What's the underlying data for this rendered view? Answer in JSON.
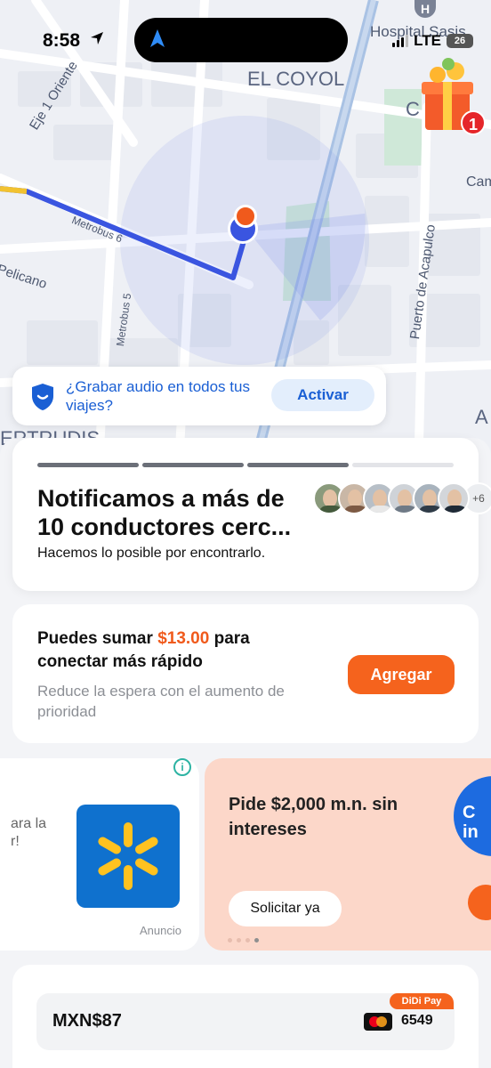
{
  "status_bar": {
    "time": "8:58",
    "network": "LTE",
    "battery": "26"
  },
  "map": {
    "labels": {
      "hospital": "Hospital Sasis",
      "neighborhood": "EL COYOL",
      "street_eje": "Eje 1 Oriente",
      "street_metrobus6": "Metrobus 6",
      "street_metrobus5": "Metrobus 5",
      "street_pelicano": "Pelicano",
      "street_acapulco": "Puerto de Acapulco",
      "street_cam": "Cam",
      "area_partial_left": "ERTRUDIS",
      "area_partial_right": "C  ES",
      "area_partial_a": "A"
    },
    "route_color": "#3a55e0",
    "pickup_color": "#f05a1c"
  },
  "gift": {
    "badge": "1"
  },
  "audio_banner": {
    "text": "¿Grabar audio en todos tus viajes?",
    "button": "Activar"
  },
  "search_card": {
    "title": "Notificamos a más de 10 conductores cerc...",
    "subtitle": "Hacemos lo posible por encontrarlo.",
    "progress_steps": [
      1,
      1,
      1,
      0
    ],
    "more_drivers": "+6"
  },
  "boost_card": {
    "title_prefix": "Puedes sumar",
    "amount": "$13.00",
    "title_suffix": "para conectar más rápido",
    "subtitle": "Reduce la espera con el aumento de prioridad",
    "button": "Agregar"
  },
  "ads": {
    "left_partial_text": "ara la\nr!",
    "left_label": "Anuncio",
    "info_icon": "i",
    "right_title": "Pide $2,000 m.n. sin intereses",
    "right_button": "Solicitar ya",
    "right_deco_text": "C\nin"
  },
  "payment": {
    "amount": "MXN$87",
    "badge": "DiDi Pay",
    "card_last4": "6549"
  },
  "colors": {
    "accent_orange": "#f5631d",
    "link_blue": "#1a5fd4",
    "progress_active": "#6b6f78",
    "progress_inactive": "#e3e4e8"
  }
}
